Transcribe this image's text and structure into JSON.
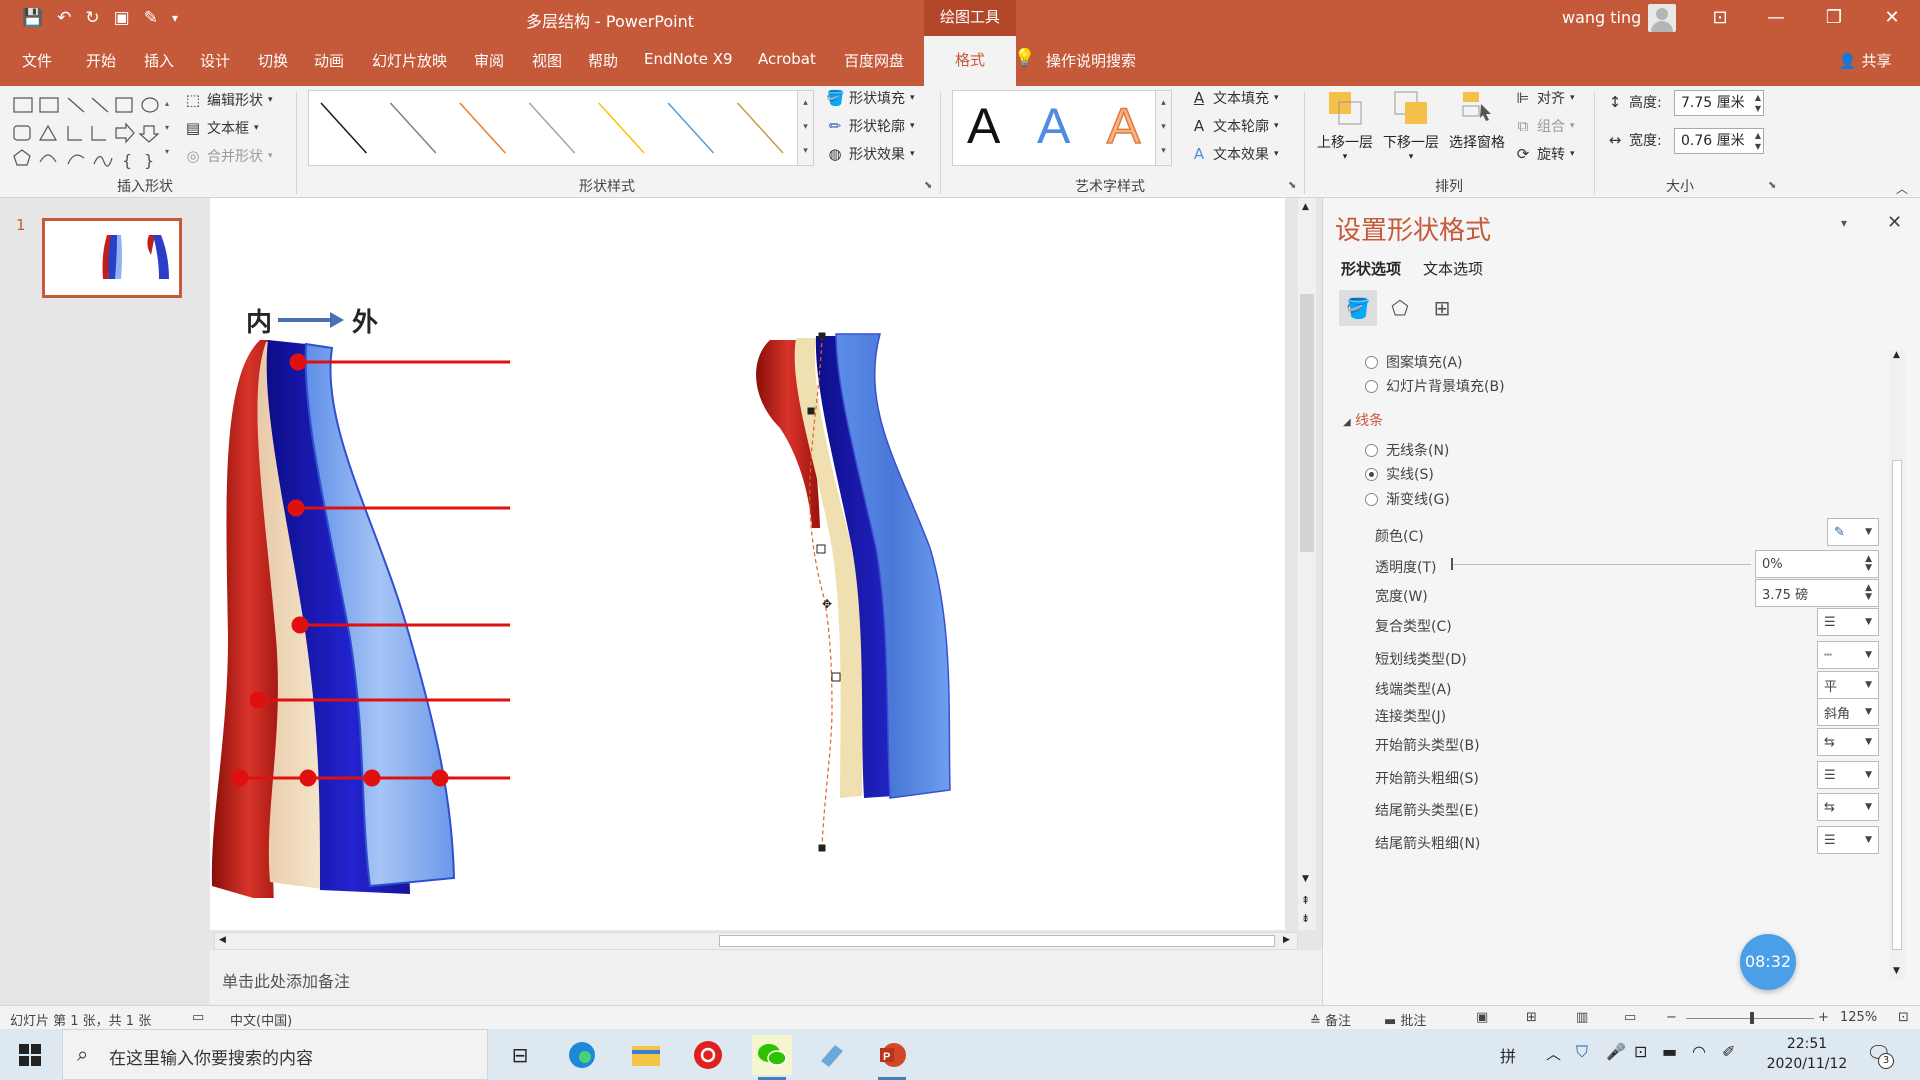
{
  "titlebar": {
    "title": "多层结构 - PowerPoint",
    "drawing_tools": "绘图工具",
    "user": "wang ting"
  },
  "tabs": [
    "文件",
    "开始",
    "插入",
    "设计",
    "切换",
    "动画",
    "幻灯片放映",
    "审阅",
    "视图",
    "帮助",
    "EndNote X9",
    "Acrobat",
    "百度网盘"
  ],
  "active_tab": "格式",
  "tell_me": "操作说明搜索",
  "share": "共享",
  "ribbon": {
    "insert_shapes": {
      "label": "插入形状",
      "edit_shape": "编辑形状",
      "text_box": "文本框",
      "merge_shapes": "合并形状"
    },
    "shape_styles": {
      "label": "形状样式",
      "fill": "形状填充",
      "outline": "形状轮廓",
      "effects": "形状效果",
      "line_colors": [
        "#1a1a1a",
        "#7f7f7f",
        "#ed7d31",
        "#a5a5a5",
        "#ffc000",
        "#5b9bd5",
        "#c0a040"
      ]
    },
    "wordart": {
      "label": "艺术字样式",
      "text_fill": "文本填充",
      "text_outline": "文本轮廓",
      "text_effects": "文本效果",
      "sample_letter": "A"
    },
    "arrange": {
      "label": "排列",
      "bring_forward": "上移一层",
      "send_backward": "下移一层",
      "selection_pane": "选择窗格",
      "align": "对齐",
      "group": "组合",
      "rotate": "旋转"
    },
    "size": {
      "label": "大小",
      "height_label": "高度:",
      "height_value": "7.75 厘米",
      "width_label": "宽度:",
      "width_value": "0.76 厘米"
    }
  },
  "slide_panel": {
    "number": "1"
  },
  "slide": {
    "label_inner": "内",
    "label_outer": "外"
  },
  "notes_placeholder": "单击此处添加备注",
  "format_pane": {
    "title": "设置形状格式",
    "tab_shape": "形状选项",
    "tab_text": "文本选项",
    "fill_options": [
      "图案填充(A)",
      "幻灯片背景填充(B)"
    ],
    "line_section": "线条",
    "line_options": [
      "无线条(N)",
      "实线(S)",
      "渐变线(G)"
    ],
    "selected_line_option": "实线(S)",
    "props": {
      "color": "颜色(C)",
      "transparency": "透明度(T)",
      "transparency_value": "0%",
      "width": "宽度(W)",
      "width_value": "3.75 磅",
      "compound": "复合类型(C)",
      "dash": "短划线类型(D)",
      "cap": "线端类型(A)",
      "cap_value": "平",
      "join": "连接类型(J)",
      "join_value": "斜角",
      "begin_arrow_type": "开始箭头类型(B)",
      "begin_arrow_size": "开始箭头粗细(S)",
      "end_arrow_type": "结尾箭头类型(E)",
      "end_arrow_size": "结尾箭头粗细(N)"
    }
  },
  "status": {
    "slide_info": "幻灯片 第 1 张，共 1 张",
    "language": "中文(中国)",
    "notes": "备注",
    "comments": "批注",
    "zoom": "125%"
  },
  "taskbar": {
    "search_placeholder": "在这里输入你要搜索的内容",
    "ime": "拼",
    "time": "22:51",
    "date": "2020/11/12",
    "notif_count": "3"
  },
  "timer_badge": "08:32",
  "colors": {
    "accent": "#c55a3a",
    "red_ribbon": "#c0201a",
    "cream": "#f3e4b8",
    "dark_blue": "#1a1ab0",
    "light_blue": "#6f9ef0"
  }
}
